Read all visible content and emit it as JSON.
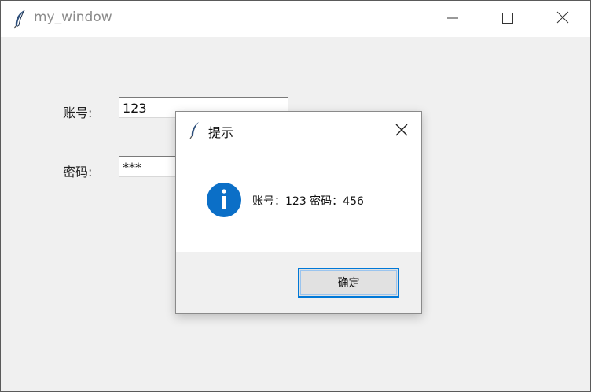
{
  "window": {
    "title": "my_window",
    "icon": "feather-icon",
    "controls": [
      "minimize-icon",
      "maximize-icon",
      "close-icon"
    ]
  },
  "form": {
    "account_label": "账号:",
    "account_value": "123",
    "password_label": "密码:",
    "password_value": "***"
  },
  "dialog": {
    "title": "提示",
    "icon": "info-icon",
    "message": "账号：123 密码：456",
    "ok_label": "确定",
    "accent_color": "#0078d7"
  }
}
